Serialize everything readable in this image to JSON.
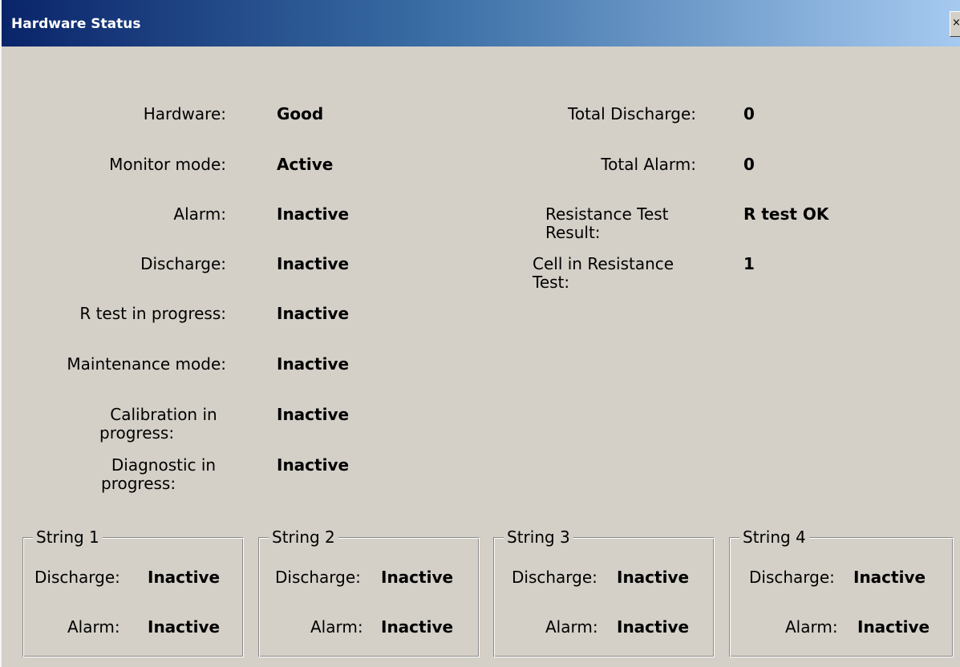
{
  "window": {
    "title": "Hardware Status",
    "close_label": "×"
  },
  "left_status": [
    {
      "label": "Hardware:",
      "value": "Good"
    },
    {
      "label": "Monitor mode:",
      "value": "Active"
    },
    {
      "label": "Alarm:",
      "value": "Inactive"
    },
    {
      "label": "Discharge:",
      "value": "Inactive"
    },
    {
      "label": "R test in progress:",
      "value": "Inactive"
    },
    {
      "label": "Maintenance mode:",
      "value": "Inactive"
    },
    {
      "label_line1": "Calibration in",
      "label_line2": "progress:",
      "value": "Inactive"
    },
    {
      "label_line1": "Diagnostic in",
      "label_line2": "progress:",
      "value": "Inactive"
    }
  ],
  "right_status": [
    {
      "label": "Total Discharge:",
      "value": "0"
    },
    {
      "label": "Total Alarm:",
      "value": "0"
    },
    {
      "label_line1": "Resistance Test",
      "label_line2": "Result:",
      "value": "R test OK"
    },
    {
      "label_line1": "Cell in Resistance",
      "label_line2": "Test:",
      "value": "1"
    }
  ],
  "strings": [
    {
      "title": "String 1",
      "discharge_label": "Discharge:",
      "discharge_value": "Inactive",
      "alarm_label": "Alarm:",
      "alarm_value": "Inactive"
    },
    {
      "title": "String 2",
      "discharge_label": "Discharge:",
      "discharge_value": "Inactive",
      "alarm_label": "Alarm:",
      "alarm_value": "Inactive"
    },
    {
      "title": "String 3",
      "discharge_label": "Discharge:",
      "discharge_value": "Inactive",
      "alarm_label": "Alarm:",
      "alarm_value": "Inactive"
    },
    {
      "title": "String 4",
      "discharge_label": "Discharge:",
      "discharge_value": "Inactive",
      "alarm_label": "Alarm:",
      "alarm_value": "Inactive"
    }
  ]
}
